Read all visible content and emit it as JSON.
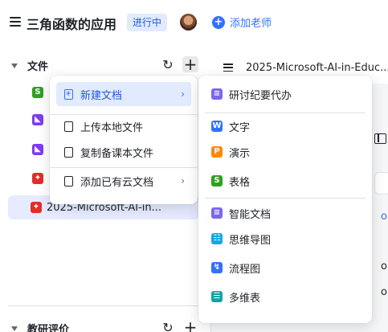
{
  "header": {
    "title": "三角函数的应用",
    "status_badge": "进行中",
    "add_teacher_label": "添加老师"
  },
  "files_section": {
    "title": "文件",
    "items": [
      {
        "icon": "sheet-icon",
        "color": "#2ea121"
      },
      {
        "icon": "image-icon",
        "color": "#7f3bf5"
      },
      {
        "icon": "image-icon",
        "color": "#7f3bf5"
      },
      {
        "icon": "pdf-icon",
        "color": "#e22e28"
      },
      {
        "icon": "pdf-icon",
        "color": "#e22e28",
        "name": "2025-Microsoft-AI-in...",
        "active": true
      }
    ]
  },
  "research_section": {
    "title": "教研评价"
  },
  "doc_tab": {
    "title": "2025-Microsoft-AI-in-Educ..."
  },
  "menu": {
    "items": [
      {
        "label": "新建文档",
        "has_submenu": true,
        "highlight": true
      },
      {
        "label": "上传本地文件"
      },
      {
        "label": "复制备课本文件"
      },
      {
        "label": "添加已有云文档",
        "has_submenu": true
      }
    ]
  },
  "submenu": {
    "items": [
      {
        "label": "研讨纪要代办",
        "icon": "docs-icon",
        "color": "#7b67ee"
      },
      {
        "label": "文字",
        "icon": "word-icon",
        "color": "#3370ff",
        "glyph": "W"
      },
      {
        "label": "演示",
        "icon": "slides-icon",
        "color": "#ff8800",
        "glyph": "P"
      },
      {
        "label": "表格",
        "icon": "sheet-icon",
        "color": "#2ea121",
        "glyph": "S"
      },
      {
        "label": "智能文档",
        "icon": "docs-icon",
        "color": "#7b67ee"
      },
      {
        "label": "思维导图",
        "icon": "mindmap-icon",
        "color": "#14a8e0"
      },
      {
        "label": "流程图",
        "icon": "flowchart-icon",
        "color": "#3370ff"
      },
      {
        "label": "多维表",
        "icon": "base-icon",
        "color": "#14a3a3"
      }
    ]
  },
  "colors": {
    "accent": "#3370ff",
    "badge_bg": "#e1eaff",
    "active_row_bg": "#e6ebff"
  }
}
